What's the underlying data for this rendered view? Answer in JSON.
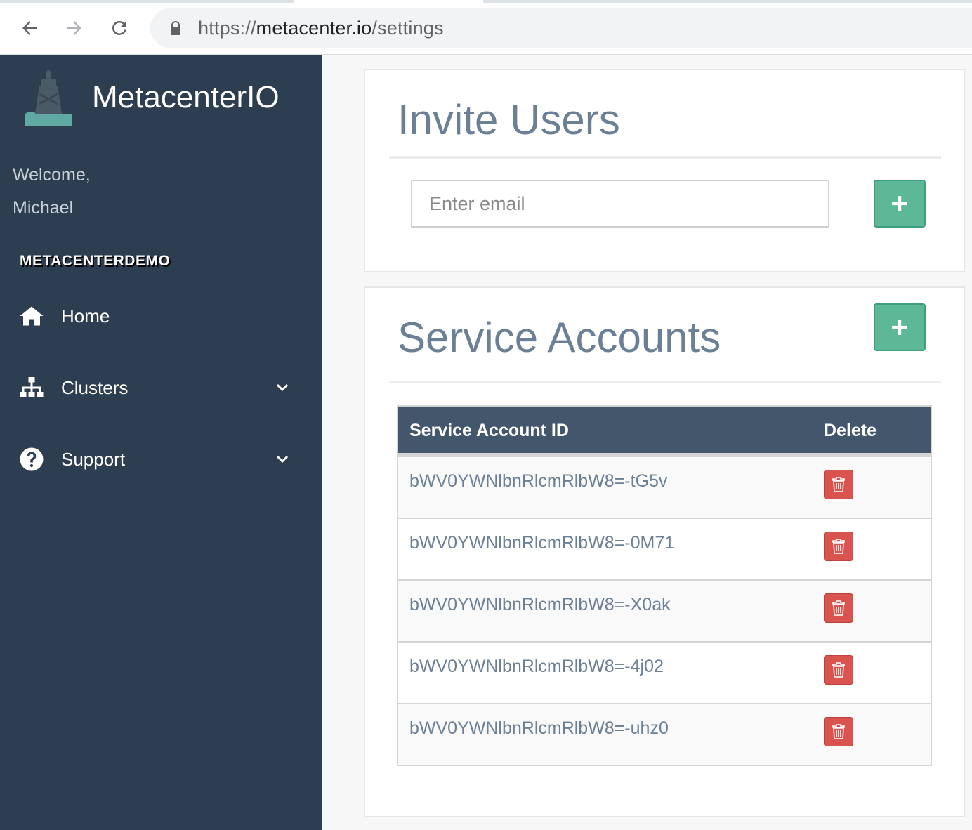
{
  "browser": {
    "url_scheme": "https://",
    "url_host": "metacenter.io",
    "url_path": "/settings"
  },
  "sidebar": {
    "brand": "MetacenterIO",
    "welcome_line1": "Welcome,",
    "welcome_line2": "Michael",
    "org_name": "METACENTERDEMO",
    "items": [
      {
        "label": "Home",
        "icon": "home-icon"
      },
      {
        "label": "Clusters",
        "icon": "sitemap-icon"
      },
      {
        "label": "Support",
        "icon": "question-circle-icon"
      }
    ]
  },
  "invite": {
    "title": "Invite Users",
    "email_placeholder": "Enter email"
  },
  "service_accounts": {
    "title": "Service Accounts",
    "columns": [
      "Service Account ID",
      "Delete"
    ],
    "rows": [
      "bWV0YWNlbnRlcmRlbW8=-tG5v",
      "bWV0YWNlbnRlcmRlbW8=-0M71",
      "bWV0YWNlbnRlcmRlbW8=-X0ak",
      "bWV0YWNlbnRlcmRlbW8=-4j02",
      "bWV0YWNlbnRlcmRlbW8=-uhz0"
    ]
  },
  "colors": {
    "sidebar_bg": "#2e3e51",
    "accent_green": "#5cb896",
    "danger_red": "#d9534f",
    "table_head": "#44566c",
    "title_slate": "#6b7f95"
  }
}
